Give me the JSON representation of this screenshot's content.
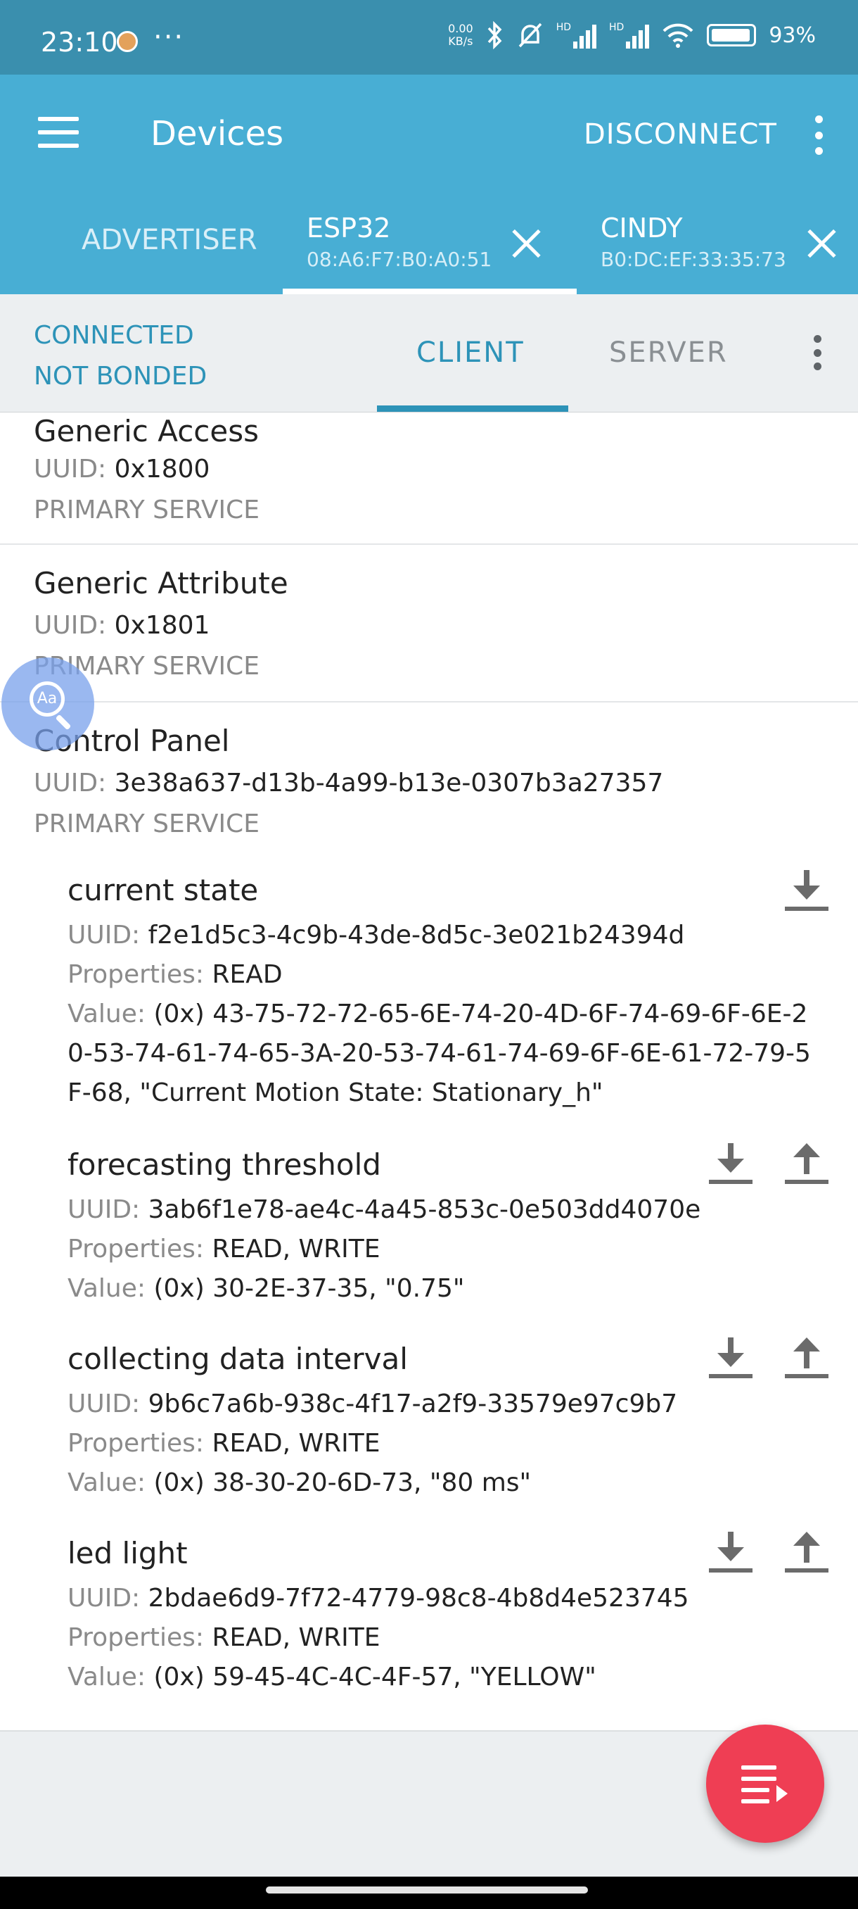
{
  "status_bar": {
    "time": "23:10",
    "more": "···",
    "net_speed_value": "0.00",
    "net_speed_unit": "KB/s",
    "network_1": "HD",
    "network_2": "HD",
    "battery": "93%"
  },
  "app_bar": {
    "title": "Devices",
    "disconnect_label": "DISCONNECT"
  },
  "device_tabs": [
    {
      "name": "ADVERTISER"
    },
    {
      "name": "ESP32",
      "mac": "08:A6:F7:B0:A0:51"
    },
    {
      "name": "CINDY",
      "mac": "B0:DC:EF:33:35:73"
    }
  ],
  "connection": {
    "state": "CONNECTED",
    "bond": "NOT BONDED",
    "tabs": [
      "CLIENT",
      "SERVER"
    ]
  },
  "labels": {
    "uuid": "UUID:",
    "properties": "Properties:",
    "value": "Value:"
  },
  "services": [
    {
      "name": "Generic Access",
      "uuid": "0x1800",
      "type": "PRIMARY SERVICE"
    },
    {
      "name": "Generic Attribute",
      "uuid": "0x1801",
      "type": "PRIMARY SERVICE"
    },
    {
      "name": "Control Panel",
      "uuid": "3e38a637-d13b-4a99-b13e-0307b3a27357",
      "type": "PRIMARY SERVICE"
    }
  ],
  "characteristics": [
    {
      "name": "current state",
      "uuid": "f2e1d5c3-4c9b-43de-8d5c-3e021b24394d",
      "properties": "READ",
      "value": "(0x) 43-75-72-72-65-6E-74-20-4D-6F-74-69-6F-6E-20-53-74-61-74-65-3A-20-53-74-61-74-69-6F-6E-61-72-79-5F-68, \"Current Motion State: Stationary_h\""
    },
    {
      "name": "forecasting threshold",
      "uuid": "3ab6f1e78-ae4c-4a45-853c-0e503dd4070e",
      "properties": "READ, WRITE",
      "value": "(0x) 30-2E-37-35, \"0.75\""
    },
    {
      "name": "collecting data interval",
      "uuid": "9b6c7a6b-938c-4f17-a2f9-33579e97c9b7",
      "properties": "READ, WRITE",
      "value": "(0x) 38-30-20-6D-73, \"80 ms\""
    },
    {
      "name": "led light",
      "uuid": "2bdae6d9-7f72-4779-98c8-4b8d4e523745",
      "properties": "READ, WRITE",
      "value": "(0x) 59-45-4C-4C-4F-57, \"YELLOW\""
    }
  ],
  "colors": {
    "status_bar": "#3a8fae",
    "app_bar": "#48aed4",
    "accent": "#2d93b8",
    "fab": "#ef3e54"
  },
  "icons": {
    "menu": "hamburger-icon",
    "overflow": "more-vert-icon",
    "close": "close-icon",
    "read": "download-arrow-icon",
    "write": "upload-arrow-icon",
    "fab": "playlist-play-icon",
    "magnifier": "text-magnifier-icon"
  },
  "magnifier_text": "Aa"
}
